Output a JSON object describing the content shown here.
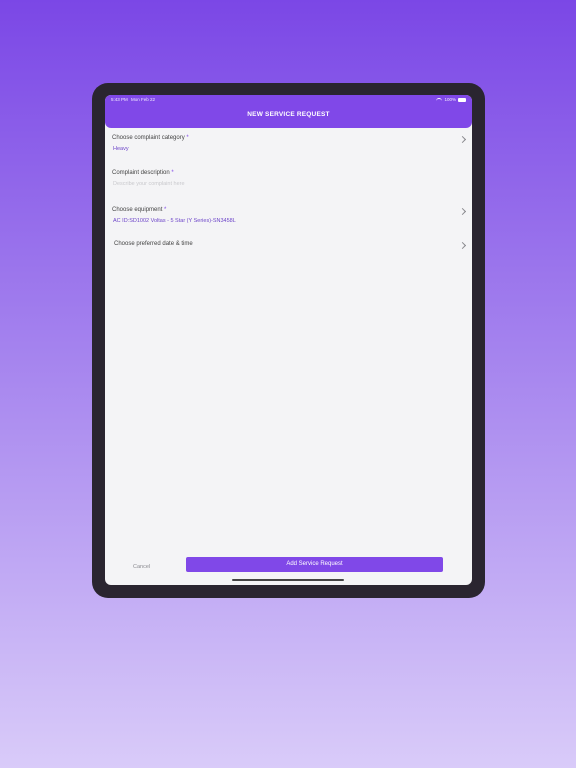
{
  "status": {
    "time": "5:43 PM",
    "date": "Mon Feb 22",
    "battery": "100%",
    "icons": [
      "wifi-icon",
      "battery-icon"
    ]
  },
  "header": {
    "title": "NEW SERVICE REQUEST"
  },
  "form": {
    "category": {
      "label": "Choose complaint category",
      "required_mark": "*",
      "value": "Heavy"
    },
    "description": {
      "label": "Complaint description",
      "required_mark": "*",
      "placeholder": "Describe your complaint here"
    },
    "equipment": {
      "label": "Choose equipment",
      "required_mark": "*",
      "value": "AC ID:SD1002 Voltas - 5 Star (Y Series)-SN3458L"
    },
    "datetime": {
      "label": "Choose preferred date & time"
    }
  },
  "actions": {
    "cancel_label": "Cancel",
    "submit_label": "Add Service Request"
  },
  "colors": {
    "accent": "#8048e8",
    "value_text": "#6d45c9",
    "background_top": "#7b47e6",
    "background_bottom": "#d9cbf9"
  }
}
